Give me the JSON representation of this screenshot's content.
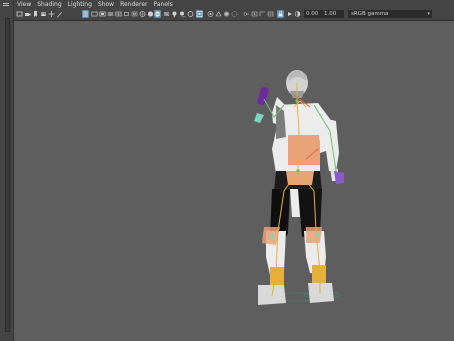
{
  "menu": {
    "items": [
      "View",
      "Shading",
      "Lighting",
      "Show",
      "Renderer",
      "Panels"
    ]
  },
  "toolbar": {
    "field_a": "0.00",
    "field_b": "1.00",
    "colorspace": "sRGB gamma"
  },
  "colors": {
    "ui_dark": "#444444",
    "viewport_bg": "#5e5e5e",
    "accent_blue": "#5a8fb8",
    "skin_orange": "#e8a37a",
    "joint_yellow": "#e4b03a",
    "bone_green": "#6fbf7a",
    "hand_purple": "#8a5cc7"
  }
}
